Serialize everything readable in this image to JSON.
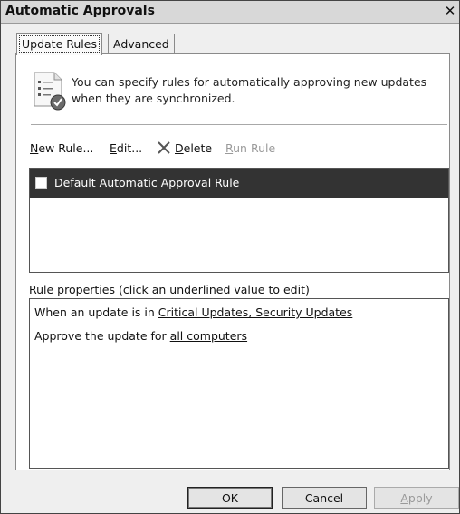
{
  "window": {
    "title": "Automatic Approvals",
    "close_glyph": "✕"
  },
  "tabs": [
    {
      "label": "Update Rules",
      "active": true
    },
    {
      "label": "Advanced",
      "active": false
    }
  ],
  "info": {
    "icon": "rules-list-check-icon",
    "text": "You can specify rules for automatically approving new updates when they are synchronized."
  },
  "toolbar": {
    "new_rule_u": "N",
    "new_rule_rest": "ew Rule...",
    "edit_u": "E",
    "edit_rest": "dit...",
    "delete_u": "D",
    "delete_rest": "elete",
    "run_rule_u": "R",
    "run_rule_rest": "un Rule"
  },
  "rules": [
    {
      "label": "Default Automatic Approval Rule",
      "checked": false,
      "selected": true
    }
  ],
  "properties": {
    "header": "Rule properties (click an underlined value to edit)",
    "line1_prefix": "When an update is in ",
    "line1_link": "Critical Updates, Security Updates",
    "line2_prefix": "Approve the update for ",
    "line2_link": "all computers"
  },
  "buttons": {
    "ok": "OK",
    "cancel": "Cancel",
    "apply_u": "A",
    "apply_rest": "pply"
  },
  "colors": {
    "selected_row": "#333333",
    "dialog_bg": "#efefef",
    "disabled_text": "#9a9a9a"
  }
}
